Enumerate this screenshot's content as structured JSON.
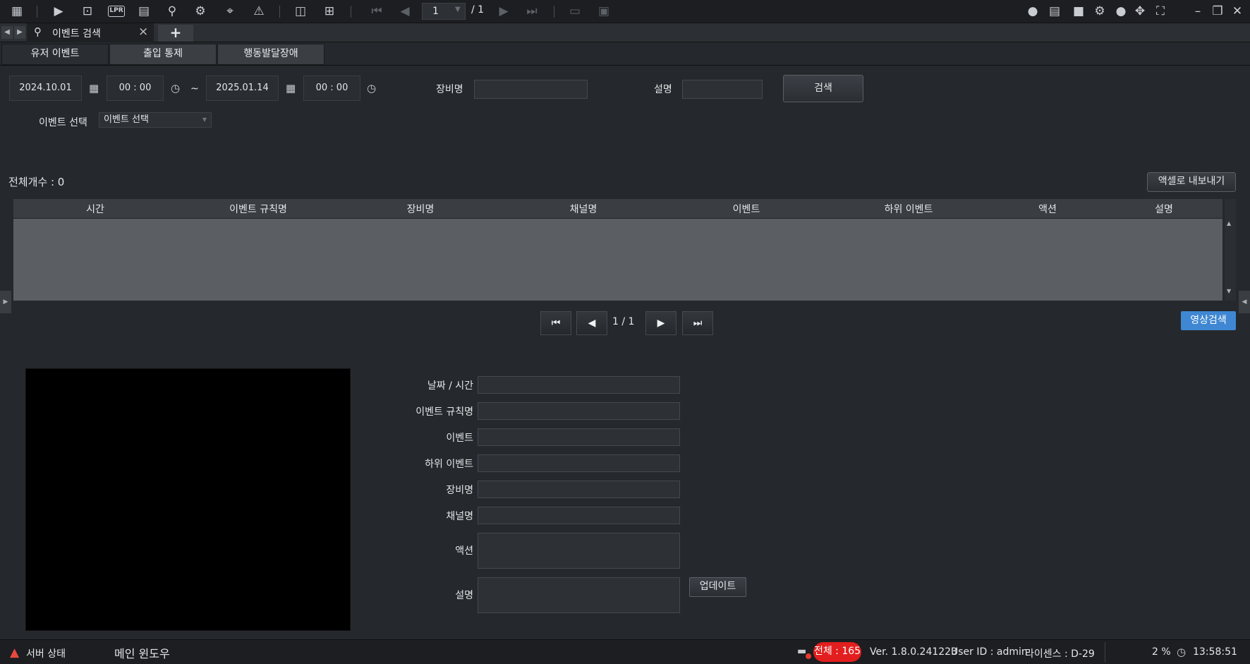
{
  "toolbar": {
    "icons": [
      "grid-menu-icon",
      "live-view-icon",
      "playback-search-icon",
      "lpr-icon",
      "event-list-icon",
      "person-search-icon",
      "bicycle-icon",
      "location-search-icon",
      "alarm-icon",
      "layout-icon",
      "add-screen-icon",
      "first-page-icon",
      "prev-page-icon",
      "next-page-icon",
      "last-page-icon",
      "monitor-icon",
      "screen-record-icon",
      "chat-icon",
      "message-icon",
      "lock-icon",
      "settings-icon",
      "user-icon",
      "move-icon",
      "fullscreen-icon",
      "minimize-icon",
      "restore-icon",
      "close-icon"
    ],
    "lpr_label": "LPR",
    "page_current": "1",
    "page_total": "/ 1"
  },
  "tabs": {
    "active_label": "이벤트 검색",
    "add_label": "+"
  },
  "subtabs": [
    "유저 이벤트",
    "출입 통제",
    "행동발달장애"
  ],
  "search": {
    "start_date": "2024.10.01",
    "start_time": "00 : 00",
    "tilde": "~",
    "end_date": "2025.01.14",
    "end_time": "00 : 00",
    "device_label": "장비명",
    "device_value": "",
    "desc_label": "설명",
    "desc_value": "",
    "search_button": "검색",
    "event_select_label": "이벤트 선택",
    "event_select_value": "이벤트 선택"
  },
  "results": {
    "total_count": "전체개수 : 0",
    "export_button": "액셀로 내보내기",
    "columns": [
      "시간",
      "이벤트 규칙명",
      "장비명",
      "채널명",
      "이벤트",
      "하위 이벤트",
      "액션",
      "설명"
    ],
    "rows": []
  },
  "pager": {
    "text": "1  /  1",
    "video_search_button": "영상검색"
  },
  "detail": {
    "labels": [
      "날짜 / 시간",
      "이벤트 규칙명",
      "이벤트",
      "하위 이벤트",
      "장비명",
      "채널명",
      "액션",
      "설명"
    ],
    "update_button": "업데이트"
  },
  "status": {
    "server_status": "서버 상태",
    "main_window": "메인 윈도우",
    "total_badge": "전체 : 165",
    "version": "Ver. 1.8.0.241223",
    "user_id": "User ID : admin",
    "license": "라이센스 : D-29",
    "cpu": "2 %",
    "clock": "13:58:51"
  },
  "colors": {
    "background": "#25282c",
    "accent_blue": "#3f87d2",
    "alert_red": "#e31e1e",
    "table_body": "#5b5e63"
  }
}
